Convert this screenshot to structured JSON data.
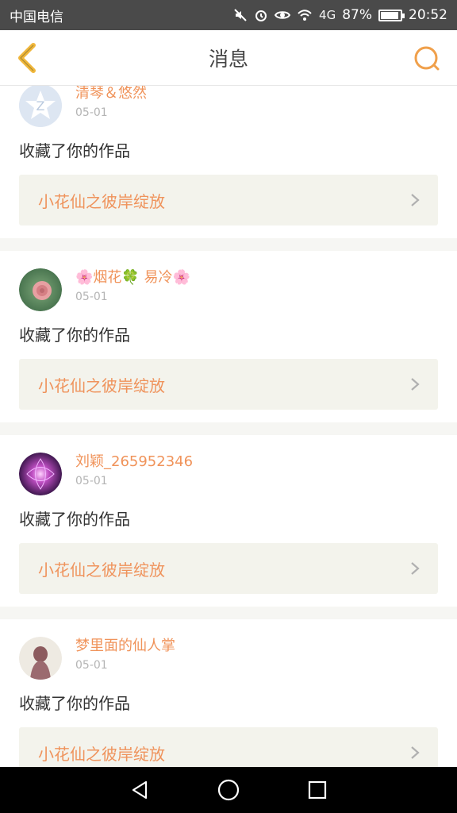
{
  "status_bar": {
    "carrier": "中国电信",
    "battery": "87%",
    "time": "20:52",
    "icons": [
      "mute-icon",
      "alarm-icon",
      "eye-icon",
      "wifi-icon",
      "signal-icon",
      "battery-icon"
    ],
    "signal_label": "4G"
  },
  "header": {
    "title": "消息",
    "back_icon": "chevron-left-icon",
    "search_icon": "search-icon",
    "accent_color": "#f0a04b"
  },
  "messages": [
    {
      "username": "清琴＆悠然",
      "date": "05-01",
      "action": "收藏了你的作品",
      "work_title": "小花仙之彼岸绽放",
      "avatar": "qq-default-avatar"
    },
    {
      "username": "🌸烟花🍀 易冷🌸",
      "date": "05-01",
      "action": "收藏了你的作品",
      "work_title": "小花仙之彼岸绽放",
      "avatar": "rose-avatar"
    },
    {
      "username": "刘颖_265952346",
      "date": "05-01",
      "action": "收藏了你的作品",
      "work_title": "小花仙之彼岸绽放",
      "avatar": "purple-light-avatar"
    },
    {
      "username": "梦里面的仙人掌",
      "date": "05-01",
      "action": "收藏了你的作品",
      "work_title": "小花仙之彼岸绽放",
      "avatar": "girl-avatar"
    }
  ],
  "nav": {
    "back": "nav-back-icon",
    "home": "nav-home-icon",
    "recent": "nav-recent-icon"
  }
}
